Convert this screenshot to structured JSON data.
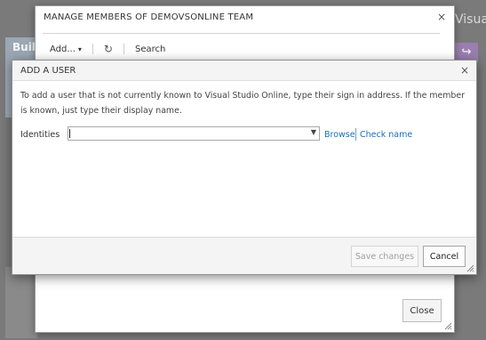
{
  "background": {
    "tile_label": "Buil",
    "title_fragment": "Visua",
    "purple_icon": "share-arrow-icon"
  },
  "outer_dialog": {
    "title": "MANAGE MEMBERS OF DEMOVSONLINE TEAM",
    "close_glyph": "×",
    "toolbar": {
      "add_label": "Add...",
      "add_caret": "▾",
      "refresh_glyph": "↻",
      "search_label": "Search"
    },
    "close_button_label": "Close"
  },
  "inner_dialog": {
    "title": "ADD A USER",
    "close_glyph": "×",
    "description": "To add a user that is not currently known to Visual Studio Online, type their sign in address. If the member is known, just type their display name.",
    "identities_label": "Identities",
    "identities_value": "",
    "dropdown_glyph": "▼",
    "browse_link": "Browse",
    "check_name_link": "Check name",
    "save_button_label": "Save changes",
    "cancel_button_label": "Cancel"
  },
  "colors": {
    "link": "#1a6fb5",
    "overlay": "#7a7a7a",
    "accent_purple": "#9a7fb0"
  }
}
